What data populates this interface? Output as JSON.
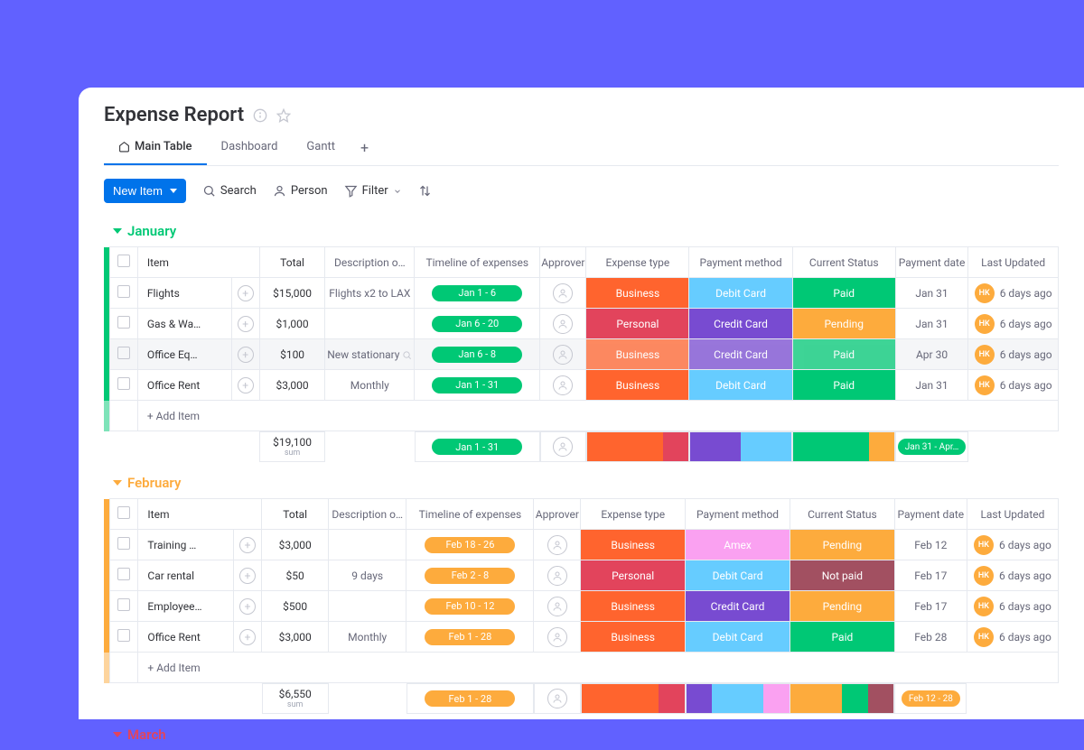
{
  "title": "Expense Report",
  "tabs": [
    {
      "label": "Main Table",
      "active": true,
      "icon": "home"
    },
    {
      "label": "Dashboard"
    },
    {
      "label": "Gantt"
    }
  ],
  "toolbar": {
    "newItem": "New Item",
    "search": "Search",
    "person": "Person",
    "filter": "Filter"
  },
  "columns": [
    "Item",
    "Total",
    "Description o…",
    "Timeline of expenses",
    "Approver",
    "Expense type",
    "Payment method",
    "Current Status",
    "Payment date",
    "Last Updated"
  ],
  "groups": [
    {
      "name": "January",
      "color": "green",
      "rows": [
        {
          "item": "Flights",
          "total": "$15,000",
          "desc": "Flights x2 to LAX",
          "timeline": "Jan 1 - 6",
          "type": "Business",
          "typeC": "bg-biz",
          "pay": "Debit Card",
          "payC": "bg-debit",
          "status": "Paid",
          "statC": "bg-paid",
          "pdate": "Jan 31",
          "updater": "HK",
          "updated": "6 days ago"
        },
        {
          "item": "Gas & Wa…",
          "total": "$1,000",
          "desc": "",
          "timeline": "Jan 6 - 20",
          "type": "Personal",
          "typeC": "bg-pers",
          "pay": "Credit Card",
          "payC": "bg-credit",
          "status": "Pending",
          "statC": "bg-pend",
          "pdate": "Jan 31",
          "updater": "HK",
          "updated": "6 days ago"
        },
        {
          "item": "Office Eq…",
          "total": "$100",
          "desc": "New stationary",
          "showMag": true,
          "timeline": "Jan 6 - 8",
          "type": "Business",
          "typeC": "bg-biz",
          "pay": "Credit Card",
          "payC": "bg-credit",
          "status": "Paid",
          "statC": "bg-paid",
          "pdate": "Apr 30",
          "updater": "HK",
          "updated": "6 days ago",
          "hovered": true,
          "faded": true
        },
        {
          "item": "Office Rent",
          "total": "$3,000",
          "desc": "Monthly",
          "timeline": "Jan 1 - 31",
          "type": "Business",
          "typeC": "bg-biz",
          "pay": "Debit Card",
          "payC": "bg-debit",
          "status": "Paid",
          "statC": "bg-paid",
          "pdate": "Jan 31",
          "updater": "HK",
          "updated": "6 days ago"
        }
      ],
      "addItem": "+ Add Item",
      "sum": {
        "total": "$19,100",
        "label": "sum",
        "timeline": "Jan 1 - 31",
        "typeBar": [
          "bg-biz",
          "bg-biz",
          "bg-biz",
          "bg-pers"
        ],
        "payBar": [
          "bg-credit",
          "bg-credit",
          "bg-debit",
          "bg-debit"
        ],
        "statBar": [
          "bg-paid",
          "bg-paid",
          "bg-paid",
          "bg-pend"
        ],
        "pdatePill": "Jan 31 - Apr…",
        "pillColor": "green"
      }
    },
    {
      "name": "February",
      "color": "orange",
      "rows": [
        {
          "item": "Training …",
          "total": "$3,000",
          "desc": "",
          "timeline": "Feb 18 - 26",
          "type": "Business",
          "typeC": "bg-biz",
          "pay": "Amex",
          "payC": "bg-amex",
          "status": "Pending",
          "statC": "bg-pend",
          "pdate": "Feb 12",
          "updater": "HK",
          "updated": "6 days ago"
        },
        {
          "item": "Car rental",
          "total": "$50",
          "desc": "9 days",
          "timeline": "Feb 2 - 8",
          "type": "Personal",
          "typeC": "bg-pers",
          "pay": "Debit Card",
          "payC": "bg-debit",
          "status": "Not paid",
          "statC": "bg-nopay",
          "pdate": "Feb 17",
          "updater": "HK",
          "updated": "6 days ago"
        },
        {
          "item": "Employee…",
          "total": "$500",
          "desc": "",
          "timeline": "Feb 10 - 12",
          "type": "Business",
          "typeC": "bg-biz",
          "pay": "Credit Card",
          "payC": "bg-credit",
          "status": "Pending",
          "statC": "bg-pend",
          "pdate": "Feb 17",
          "updater": "HK",
          "updated": "6 days ago"
        },
        {
          "item": "Office Rent",
          "total": "$3,000",
          "desc": "Monthly",
          "timeline": "Feb 1 - 28",
          "type": "Business",
          "typeC": "bg-biz",
          "pay": "Debit Card",
          "payC": "bg-debit",
          "status": "Paid",
          "statC": "bg-paid",
          "pdate": "Feb 28",
          "updater": "HK",
          "updated": "6 days ago"
        }
      ],
      "addItem": "+ Add Item",
      "sum": {
        "total": "$6,550",
        "label": "sum",
        "timeline": "Feb 1 - 28",
        "typeBar": [
          "bg-biz",
          "bg-biz",
          "bg-biz",
          "bg-pers"
        ],
        "payBar": [
          "bg-credit",
          "bg-debit",
          "bg-debit",
          "bg-amex"
        ],
        "statBar": [
          "bg-pend",
          "bg-pend",
          "bg-paid",
          "bg-nopay"
        ],
        "pdatePill": "Feb 12 - 28",
        "pillColor": "orange"
      }
    },
    {
      "name": "March",
      "color": "red",
      "rows": [],
      "collapsed": true
    }
  ]
}
